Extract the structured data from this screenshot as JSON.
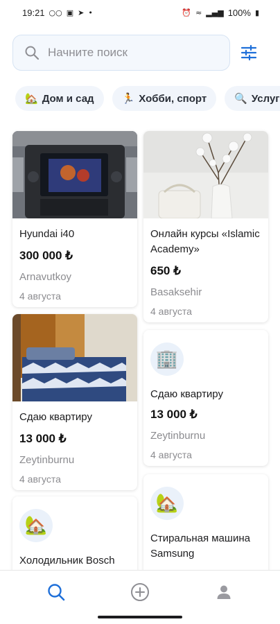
{
  "status_bar": {
    "time": "19:21",
    "battery": "100%",
    "left_icons": [
      "voicemail-icon",
      "gallery-icon",
      "telegram-icon",
      "dot-icon"
    ],
    "right_icons": [
      "alarm-icon",
      "wifi-icon",
      "signal-icon",
      "battery-icon"
    ]
  },
  "search": {
    "placeholder": "Начните поиск",
    "value": ""
  },
  "categories": [
    {
      "label": "Дом и сад",
      "icon": "house-garden-icon"
    },
    {
      "label": "Хобби, спорт",
      "icon": "running-icon"
    },
    {
      "label": "Услуги",
      "icon": "magnifier-icon"
    }
  ],
  "listings": [
    {
      "title": "Hyundai i40",
      "price": "300 000 ₺",
      "location": "Arnavutkoy",
      "date": "4 августа",
      "image": "car-dashboard-photo"
    },
    {
      "title": "Онлайн курсы «Islamic Academy»",
      "price": "650 ₺",
      "location": "Basaksehir",
      "date": "4 августа",
      "image": "cotton-vase-photo"
    },
    {
      "title": "Сдаю квартиру",
      "price": "13 000 ₺",
      "location": "Zeytinburnu",
      "date": "4 августа",
      "image": "bedroom-photo"
    },
    {
      "title": "Сдаю квартиру",
      "price": "13 000 ₺",
      "location": "Zeytinburnu",
      "date": "4 августа",
      "image": "office-building-icon"
    },
    {
      "title": "Холодильник Bosch",
      "price": "",
      "location": "",
      "date": "",
      "image": "house-garden-icon"
    },
    {
      "title": "Стиральная машина Samsung",
      "price": "",
      "location": "",
      "date": "",
      "image": "house-garden-icon"
    }
  ],
  "bottom_nav": {
    "items": [
      {
        "name": "search-tab",
        "icon": "search-icon",
        "active": true
      },
      {
        "name": "add-listing-tab",
        "icon": "plus-circle-icon",
        "active": false
      },
      {
        "name": "profile-tab",
        "icon": "profile-icon",
        "active": false
      }
    ]
  },
  "colors": {
    "accent": "#1e6fd9",
    "search_bg": "#f4f8fd",
    "chip_bg": "#f1f5fb",
    "muted_text": "#8b8b8f"
  }
}
